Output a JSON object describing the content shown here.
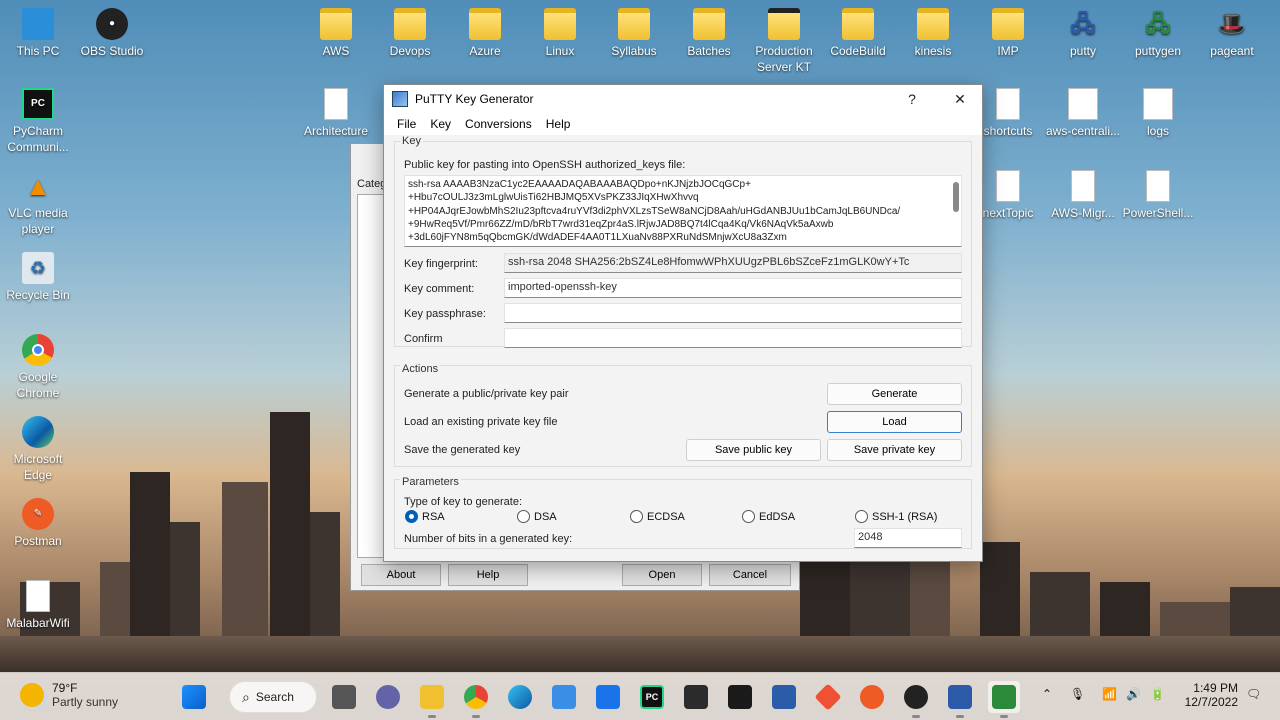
{
  "desktop": {
    "icons_left": [
      {
        "label": "This PC",
        "icon": "monitor-icon"
      },
      {
        "label": "OBS Studio",
        "icon": "obs-icon"
      },
      {
        "label": "PyCharm Communi...",
        "icon": "pycharm-icon"
      },
      {
        "label": "VLC media player",
        "icon": "vlc-icon"
      },
      {
        "label": "Recycle Bin",
        "icon": "recycle-bin-icon"
      },
      {
        "label": "Google Chrome",
        "icon": "chrome-icon"
      },
      {
        "label": "Microsoft Edge",
        "icon": "edge-icon"
      },
      {
        "label": "Postman",
        "icon": "postman-icon"
      },
      {
        "label": "MalabarWifi",
        "icon": "document-icon"
      }
    ],
    "icons_top": [
      {
        "label": "AWS"
      },
      {
        "label": "Devops"
      },
      {
        "label": "Azure"
      },
      {
        "label": "Linux"
      },
      {
        "label": "Syllabus"
      },
      {
        "label": "Batches"
      },
      {
        "label": "Production Server KT"
      },
      {
        "label": "CodeBuild"
      },
      {
        "label": "kinesis"
      },
      {
        "label": "IMP"
      },
      {
        "label": "putty"
      },
      {
        "label": "puttygen"
      },
      {
        "label": "pageant"
      }
    ],
    "icons_mid": [
      {
        "label": "Architecture"
      },
      {
        "label": "shortcuts"
      },
      {
        "label": "aws-centrali..."
      },
      {
        "label": "logs"
      },
      {
        "label": "nextTopic"
      },
      {
        "label": "AWS-Migr..."
      },
      {
        "label": "PowerShell..."
      }
    ],
    "back_dialog": {
      "sidebar_label": "Categ",
      "about": "About",
      "help": "Help",
      "open": "Open",
      "cancel": "Cancel"
    }
  },
  "window": {
    "title": "PuTTY Key Generator",
    "help_btn": "?",
    "close_btn": "✕",
    "menu": [
      "File",
      "Key",
      "Conversions",
      "Help"
    ],
    "key_group": "Key",
    "public_key_label": "Public key for pasting into OpenSSH authorized_keys file:",
    "public_key_lines": [
      "ssh-rsa AAAAB3NzaC1yc2EAAAADAQABAAABAQDpo+nKJNjzbJOCqGCp+",
      "+Hbu7cOULJ3z3mLglwUisTi62HBJMQ5XVsPKZ33JIqXHwXhvvq",
      "+HP04AJqrEJowbMhS2Iu23pftcva4ruYVf3di2phVXLzsTSeW8aNCjD8Aah/uHGdANBJUu1bCamJqLB6UNDca/",
      "+9HwReq5Vf/Pmr66ZZ/mD/bRbT7wrd31eqZpr4aS.lRjwJAD8BQ7t4lCqa4Kq/Vk6NAqVk5aAxwb",
      "+3dL60jFYN8m5qQbcmGK/dWdADEF4AA0T1LXuaNv88PXRuNdSMnjwXcU8a3Zxm"
    ],
    "fingerprint_label": "Key fingerprint:",
    "fingerprint_value": "ssh-rsa 2048 SHA256:2bSZ4Le8HfomwWPhXUUgzPBL6bSZceFz1mGLK0wY+Tc",
    "comment_label": "Key comment:",
    "comment_value": "imported-openssh-key",
    "passphrase_label": "Key passphrase:",
    "passphrase_value": "",
    "confirm_label": "Confirm",
    "confirm_value": "",
    "actions_group": "Actions",
    "generate_label": "Generate a public/private key pair",
    "generate_btn": "Generate",
    "load_label": "Load an existing private key file",
    "load_btn": "Load",
    "save_label": "Save the generated key",
    "save_public_btn": "Save public key",
    "save_private_btn": "Save private key",
    "params_group": "Parameters",
    "type_label": "Type of key to generate:",
    "key_types": [
      "RSA",
      "DSA",
      "ECDSA",
      "EdDSA",
      "SSH-1 (RSA)"
    ],
    "selected_type": "RSA",
    "bits_label": "Number of bits in a generated key:",
    "bits_value": "2048"
  },
  "taskbar": {
    "weather_temp": "79°F",
    "weather_desc": "Partly sunny",
    "search_label": "Search",
    "time": "1:49 PM",
    "date": "12/7/2022"
  },
  "colors": {
    "accent": "#005fb8",
    "folder": "#f0c030"
  }
}
